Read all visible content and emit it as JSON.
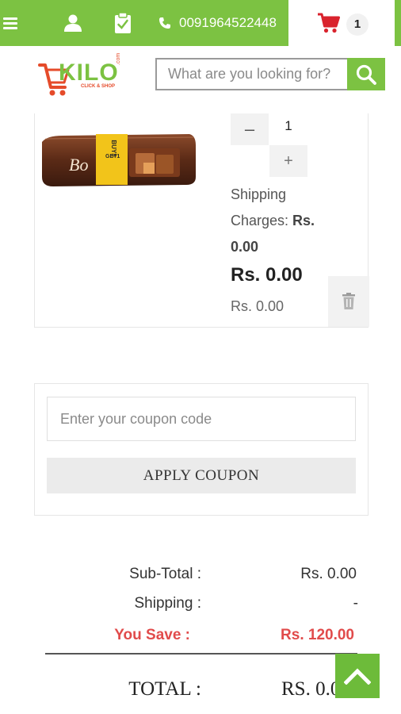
{
  "topbar": {
    "phone": "0091964522448",
    "cart_count": "1"
  },
  "logo": {
    "brand": "KILO",
    "tagline": "CLICK & SHOP",
    "suffix": ".com"
  },
  "search": {
    "placeholder": "What are you looking for?"
  },
  "product": {
    "quantity": "1",
    "minus_label": "–",
    "plus_label": "+",
    "shipping_text": "Shipping Charges: ",
    "shipping_value": "Rs. 0.00",
    "price": "Rs. 0.00",
    "subprice": "Rs. 0.00"
  },
  "coupon": {
    "placeholder": "Enter your coupon code",
    "apply_label": "APPLY COUPON"
  },
  "totals": {
    "subtotal_label": "Sub-Total :",
    "subtotal_value": "Rs. 0.00",
    "shipping_label": "Shipping :",
    "shipping_value": "-",
    "save_label": "You Save :",
    "save_value": "Rs. 120.00",
    "total_label": "TOTAL :",
    "total_value": "RS. 0.0"
  },
  "colors": {
    "brand_green": "#7cc242",
    "cart_red": "#d9232d",
    "save_red": "#e14b4b"
  }
}
